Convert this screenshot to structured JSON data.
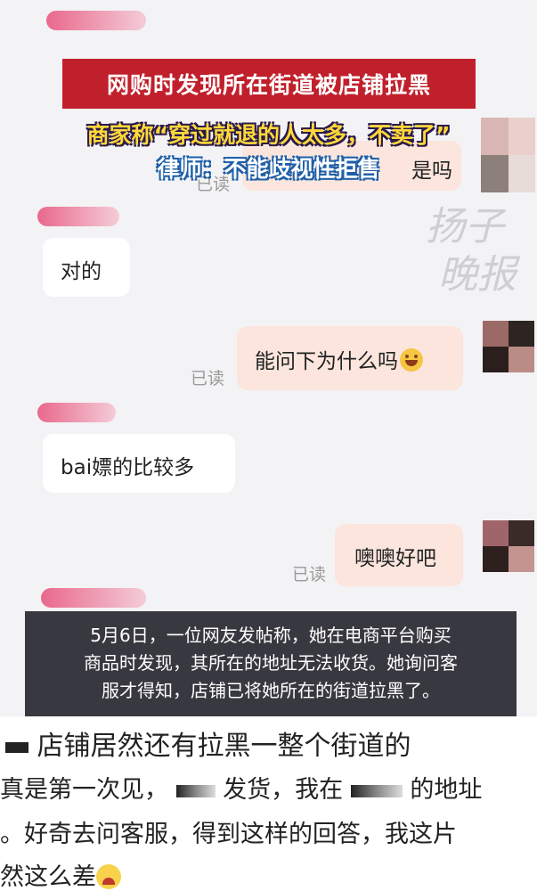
{
  "chat": {
    "partial_msg_right": "是吗",
    "partial_read": "已读",
    "messages": [
      {
        "side": "left",
        "text": "对的"
      },
      {
        "side": "right",
        "text": "能问下为什么吗",
        "read": "已读"
      },
      {
        "side": "left",
        "text": "bai嫖的比较多"
      },
      {
        "side": "right",
        "text": "噢噢好吧",
        "read": "已读"
      }
    ]
  },
  "overlay": {
    "title": "网购时发现所在街道被店铺拉黑",
    "subtitle_1": "商家称“穿过就退的人太多，不卖了”",
    "subtitle_2": "律师：不能歧视性拒售",
    "watermark_line1": "扬子",
    "watermark_line2": "晚报",
    "caption_lines": [
      "5月6日，一位网友发帖称，她在电商平台购买",
      "商品时发现，其所在的地址无法收货。她询问客",
      "服才得知，店铺已将她所在的街道拉黑了。"
    ]
  },
  "post": {
    "title": "店铺居然还有拉黑一整个街道的",
    "line1_a": "真是第一次见，",
    "line1_b": "发货，我在",
    "line1_c": "的地址",
    "line2": "。好奇去问客服，得到这样的回答，我这片",
    "line3": "然这么差"
  },
  "colors": {
    "banner_red": "#c0202c",
    "subtitle_yellow": "#ffd83a",
    "right_bubble": "#fbe5dd",
    "caption_bg": "#28282f"
  }
}
